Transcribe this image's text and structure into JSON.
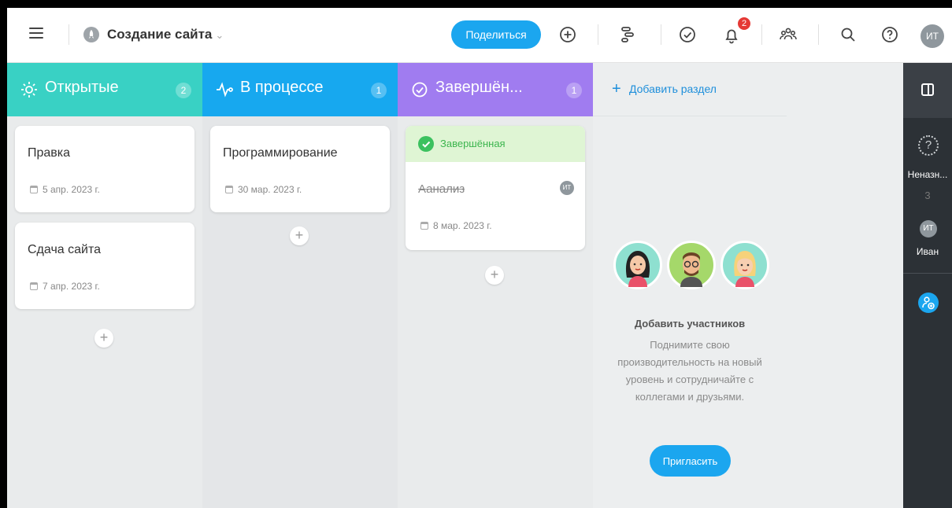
{
  "header": {
    "project_title": "Создание сайта",
    "share_label": "Поделиться",
    "notifications_count": "2",
    "user_initials": "ИТ"
  },
  "columns": [
    {
      "title": "Открытые",
      "count": "2",
      "color": "#39d1c4",
      "cards": [
        {
          "title": "Правка",
          "date": "5 апр. 2023 г."
        },
        {
          "title": "Сдача сайта",
          "date": "7 апр. 2023 г."
        }
      ]
    },
    {
      "title": "В процессе",
      "count": "1",
      "color": "#17a8ef",
      "cards": [
        {
          "title": "Программирование",
          "date": "30 мар. 2023 г."
        }
      ]
    },
    {
      "title": "Завершён...",
      "count": "1",
      "color": "#a07cf0",
      "cards": [
        {
          "status": "Завершённая",
          "title": "Аанализ",
          "date": "8 мар. 2023 г.",
          "assignee": "ИТ"
        }
      ]
    }
  ],
  "add_section": {
    "label": "Добавить раздел",
    "invite_title": "Добавить участников",
    "invite_text": "Поднимите свою производительность на новый уровень и сотрудничайте с коллегами и друзьями.",
    "invite_button": "Пригласить"
  },
  "right_sidebar": {
    "unassigned_label": "Неназн...",
    "unassigned_count": "3",
    "user_initials": "ИТ",
    "user_name": "Иван"
  },
  "icons": {
    "menu": "hamburger-icon",
    "project": "rocket-icon",
    "add": "plus-circle-icon",
    "timeline": "timeline-icon",
    "tasks": "check-circle-icon",
    "notifications": "bell-icon",
    "team": "users-icon",
    "search": "search-icon",
    "help": "help-icon",
    "panel": "panel-toggle-icon",
    "invite": "add-user-icon"
  },
  "colors": {
    "accent": "#1ba6ef",
    "open": "#39d1c4",
    "in_progress": "#17a8ef",
    "done": "#a07cf0",
    "done_green": "#3cc15f",
    "sidebar": "#2c3136"
  }
}
